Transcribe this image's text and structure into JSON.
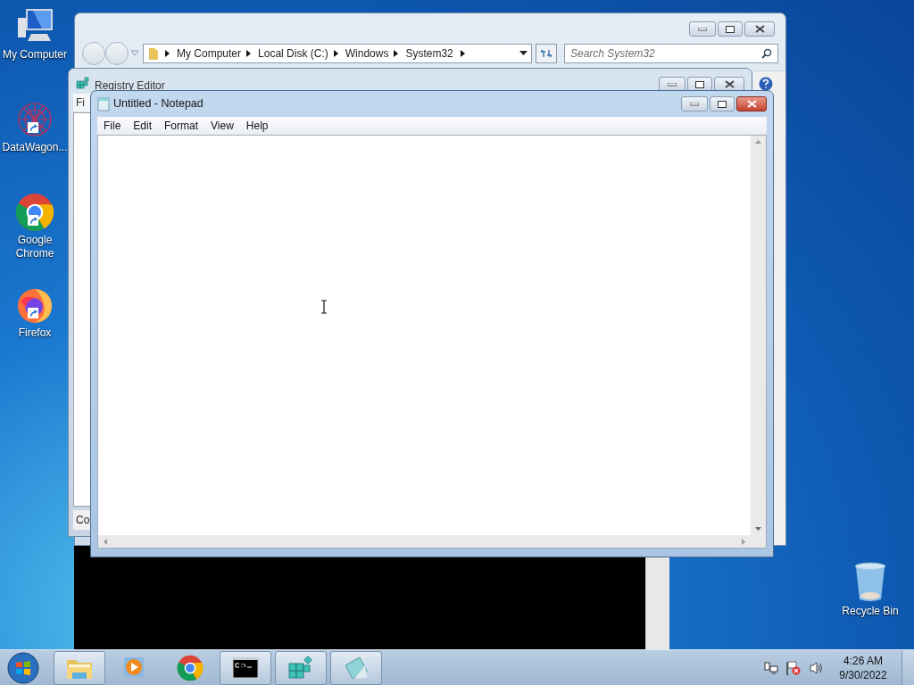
{
  "desktop_icons": [
    {
      "kind": "computer",
      "label": "My Computer"
    },
    {
      "kind": "network",
      "label": "DataWagon..."
    },
    {
      "kind": "chrome",
      "label": "Google Chrome"
    },
    {
      "kind": "firefox",
      "label": "Firefox"
    }
  ],
  "recycle_bin": {
    "label": "Recycle Bin"
  },
  "explorer": {
    "breadcrumbs": [
      "My Computer",
      "Local Disk (C:)",
      "Windows",
      "System32"
    ],
    "search": {
      "placeholder": "Search System32"
    }
  },
  "registry_editor": {
    "title": "Registry Editor",
    "menu_fragment": "Fi",
    "status_fragment": "Co"
  },
  "notepad": {
    "title": "Untitled - Notepad",
    "menu": [
      "File",
      "Edit",
      "Format",
      "View",
      "Help"
    ]
  },
  "taskbar": {
    "items": [
      {
        "kind": "explorer",
        "running": true
      },
      {
        "kind": "media",
        "running": false
      },
      {
        "kind": "chrome",
        "running": false
      },
      {
        "kind": "console",
        "running": true
      },
      {
        "kind": "registry",
        "running": true
      },
      {
        "kind": "notepad",
        "running": true
      }
    ],
    "clock": {
      "time": "4:26 AM",
      "date": "9/30/2022"
    }
  }
}
